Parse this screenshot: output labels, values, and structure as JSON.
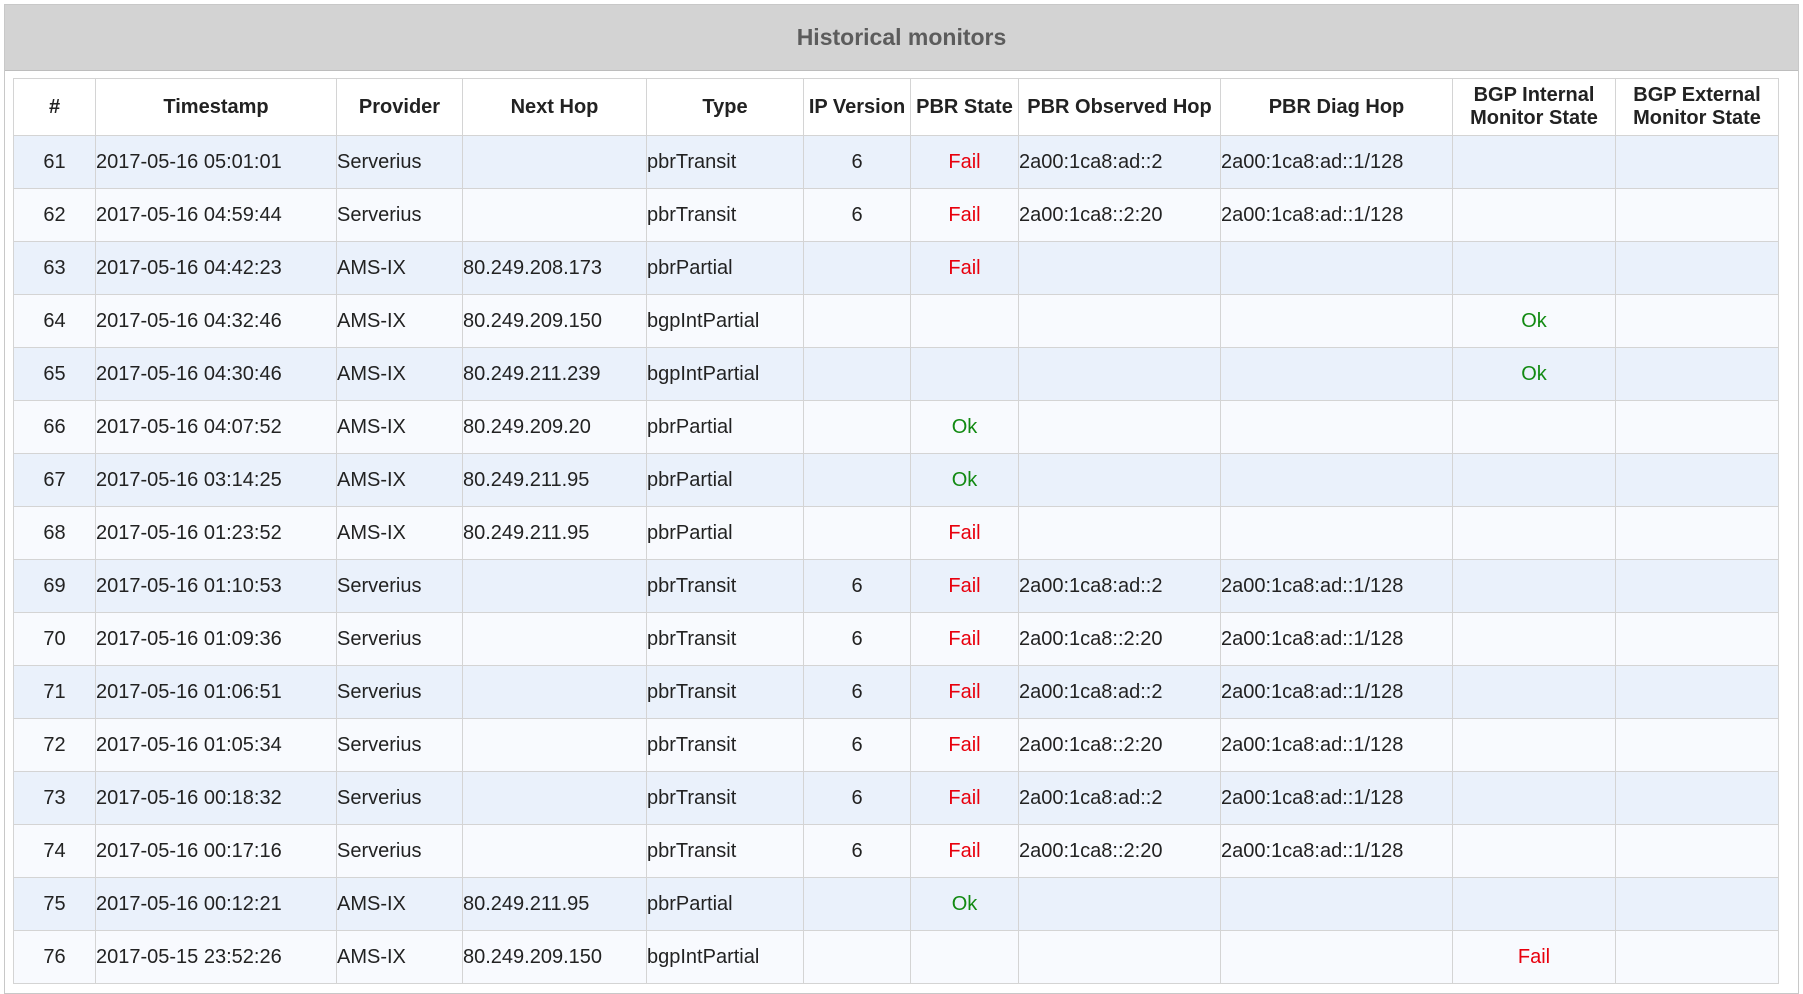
{
  "panel": {
    "title": "Historical monitors"
  },
  "colors": {
    "header_bg": "#d3d3d3",
    "row_odd": "#eaf1fb",
    "row_even": "#f8fafe",
    "fail": "#e8000d",
    "ok": "#128a12"
  },
  "table": {
    "columns": [
      "#",
      "Timestamp",
      "Provider",
      "Next Hop",
      "Type",
      "IP Version",
      "PBR State",
      "PBR Observed Hop",
      "PBR Diag Hop",
      "BGP Internal Monitor State",
      "BGP External Monitor State"
    ],
    "rows": [
      [
        "61",
        "2017-05-16 05:01:01",
        "Serverius",
        "",
        "pbrTransit",
        "6",
        "Fail",
        "2a00:1ca8:ad::2",
        "2a00:1ca8:ad::1/128",
        "",
        ""
      ],
      [
        "62",
        "2017-05-16 04:59:44",
        "Serverius",
        "",
        "pbrTransit",
        "6",
        "Fail",
        "2a00:1ca8::2:20",
        "2a00:1ca8:ad::1/128",
        "",
        ""
      ],
      [
        "63",
        "2017-05-16 04:42:23",
        "AMS-IX",
        "80.249.208.173",
        "pbrPartial",
        "",
        "Fail",
        "",
        "",
        "",
        ""
      ],
      [
        "64",
        "2017-05-16 04:32:46",
        "AMS-IX",
        "80.249.209.150",
        "bgpIntPartial",
        "",
        "",
        "",
        "",
        "Ok",
        ""
      ],
      [
        "65",
        "2017-05-16 04:30:46",
        "AMS-IX",
        "80.249.211.239",
        "bgpIntPartial",
        "",
        "",
        "",
        "",
        "Ok",
        ""
      ],
      [
        "66",
        "2017-05-16 04:07:52",
        "AMS-IX",
        "80.249.209.20",
        "pbrPartial",
        "",
        "Ok",
        "",
        "",
        "",
        ""
      ],
      [
        "67",
        "2017-05-16 03:14:25",
        "AMS-IX",
        "80.249.211.95",
        "pbrPartial",
        "",
        "Ok",
        "",
        "",
        "",
        ""
      ],
      [
        "68",
        "2017-05-16 01:23:52",
        "AMS-IX",
        "80.249.211.95",
        "pbrPartial",
        "",
        "Fail",
        "",
        "",
        "",
        ""
      ],
      [
        "69",
        "2017-05-16 01:10:53",
        "Serverius",
        "",
        "pbrTransit",
        "6",
        "Fail",
        "2a00:1ca8:ad::2",
        "2a00:1ca8:ad::1/128",
        "",
        ""
      ],
      [
        "70",
        "2017-05-16 01:09:36",
        "Serverius",
        "",
        "pbrTransit",
        "6",
        "Fail",
        "2a00:1ca8::2:20",
        "2a00:1ca8:ad::1/128",
        "",
        ""
      ],
      [
        "71",
        "2017-05-16 01:06:51",
        "Serverius",
        "",
        "pbrTransit",
        "6",
        "Fail",
        "2a00:1ca8:ad::2",
        "2a00:1ca8:ad::1/128",
        "",
        ""
      ],
      [
        "72",
        "2017-05-16 01:05:34",
        "Serverius",
        "",
        "pbrTransit",
        "6",
        "Fail",
        "2a00:1ca8::2:20",
        "2a00:1ca8:ad::1/128",
        "",
        ""
      ],
      [
        "73",
        "2017-05-16 00:18:32",
        "Serverius",
        "",
        "pbrTransit",
        "6",
        "Fail",
        "2a00:1ca8:ad::2",
        "2a00:1ca8:ad::1/128",
        "",
        ""
      ],
      [
        "74",
        "2017-05-16 00:17:16",
        "Serverius",
        "",
        "pbrTransit",
        "6",
        "Fail",
        "2a00:1ca8::2:20",
        "2a00:1ca8:ad::1/128",
        "",
        ""
      ],
      [
        "75",
        "2017-05-16 00:12:21",
        "AMS-IX",
        "80.249.211.95",
        "pbrPartial",
        "",
        "Ok",
        "",
        "",
        "",
        ""
      ],
      [
        "76",
        "2017-05-15 23:52:26",
        "AMS-IX",
        "80.249.209.150",
        "bgpIntPartial",
        "",
        "",
        "",
        "",
        "Fail",
        ""
      ]
    ]
  }
}
